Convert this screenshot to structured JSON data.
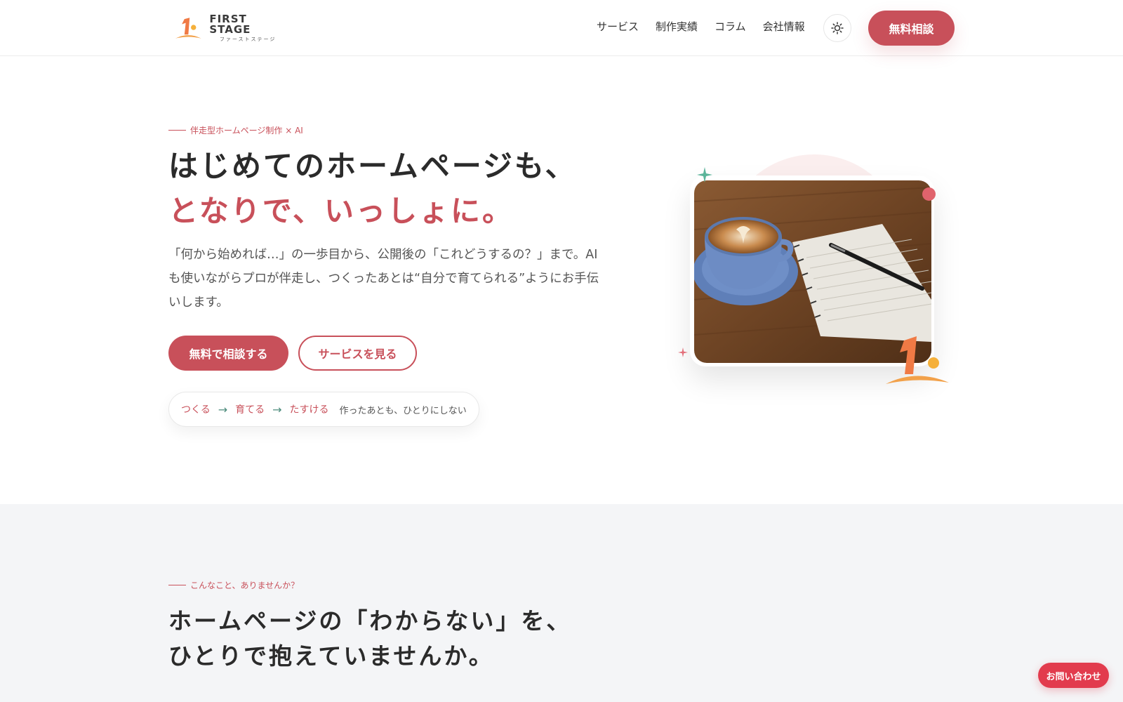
{
  "header": {
    "logo_main": "FIRST STAGE",
    "logo_sub": "ファーストステージ",
    "nav": [
      "サービス",
      "制作実績",
      "コラム",
      "会社情報"
    ],
    "theme_toggle_icon": "sun-icon",
    "cta_label": "無料相談"
  },
  "hero": {
    "eyebrow": "伴走型ホームページ制作 × AI",
    "title_line1": "はじめてのホームページも、",
    "title_line2": "となりで、いっしょに。",
    "lead": "「何から始めれば…」の一歩目から、公開後の「これどうするの？」まで。AIも使いながらプロが伴走し、つくったあとは“自分で育てられる”ようにお手伝いします。",
    "primary_button": "無料で相談する",
    "secondary_button": "サービスを見る",
    "steps": [
      "つくる",
      "育てる",
      "たすける"
    ],
    "steps_note": "作ったあとも、ひとりにしない"
  },
  "section2": {
    "eyebrow": "こんなこと、ありませんか？",
    "title_line1": "ホームページの「わからない」を、",
    "title_line2": "ひとりで抱えていませんか。"
  },
  "floating": {
    "contact_label": "お問い合わせ"
  },
  "colors": {
    "accent": "#c8505a",
    "floating_button": "#e23b4d",
    "teal": "#4a8a7a",
    "section_bg": "#f4f5f7"
  }
}
